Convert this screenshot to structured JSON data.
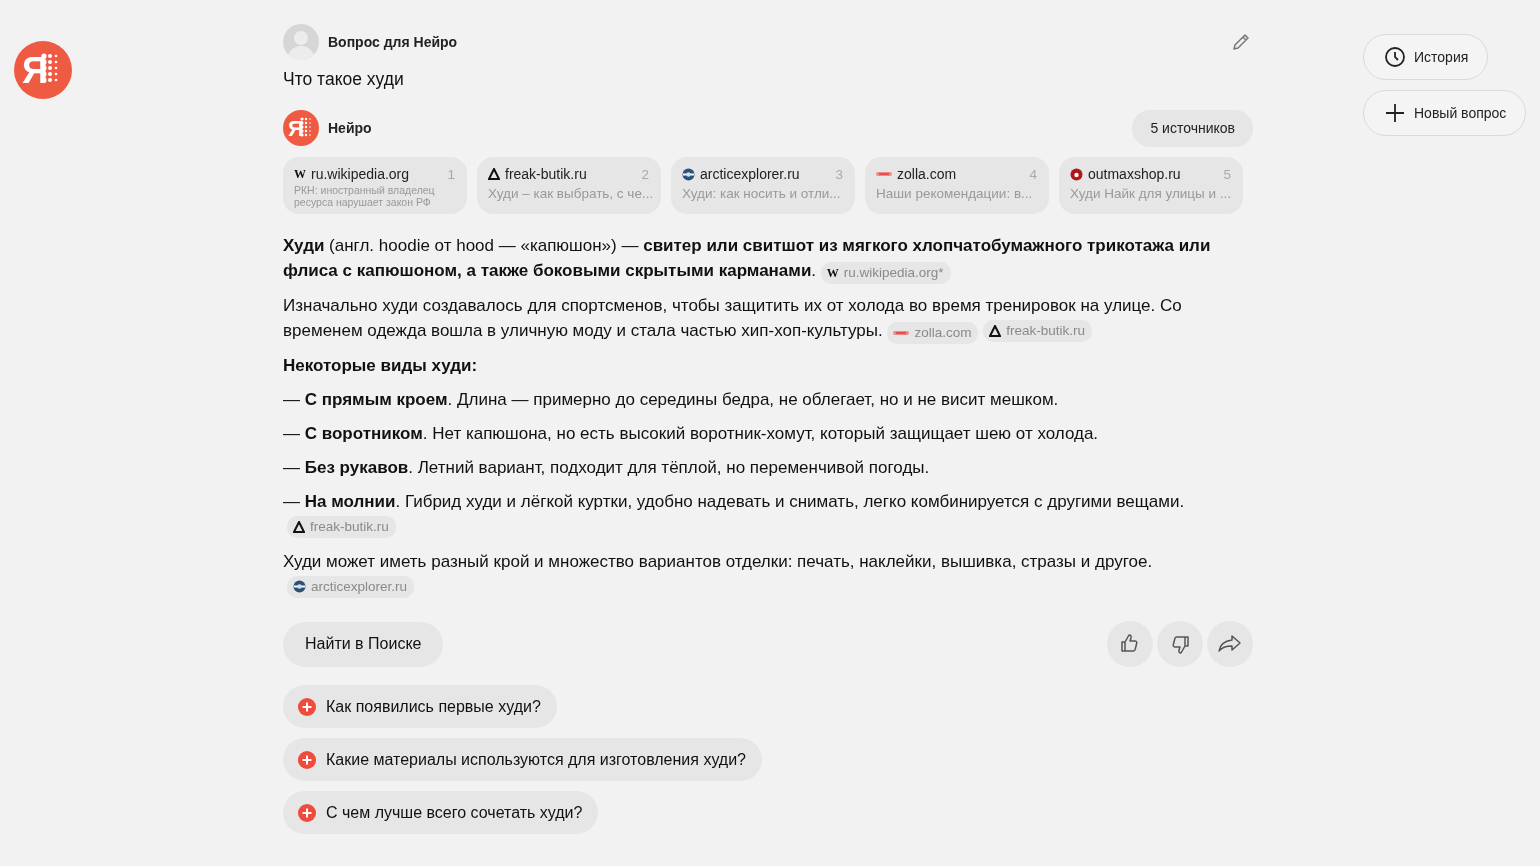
{
  "logo": {
    "letter": "Я"
  },
  "question": {
    "author": "Вопрос для Нейро",
    "text": "Что такое худи"
  },
  "answer": {
    "author": "Нейро",
    "author_letter": "Я",
    "sources_button": "5 источников",
    "sources": [
      {
        "domain": "ru.wikipedia.org",
        "number": "1",
        "snippet": "РКН: иностранный владелец ресурса нарушает закон РФ",
        "kind": "letter",
        "icon_text": "W",
        "warning": true
      },
      {
        "domain": "freak-butik.ru",
        "number": "2",
        "snippet": "Худи – как выбрать, с че...",
        "kind": "triangle",
        "warning": false
      },
      {
        "domain": "arcticexplorer.ru",
        "number": "3",
        "snippet": "Худи: как носить и отли...",
        "kind": "globe",
        "warning": false
      },
      {
        "domain": "zolla.com",
        "number": "4",
        "snippet": "Наши рекомендации: в...",
        "kind": "stripe",
        "warning": false
      },
      {
        "domain": "outmaxshop.ru",
        "number": "5",
        "snippet": "Худи Найк для улицы и ...",
        "kind": "dot",
        "warning": false
      }
    ],
    "blocks": [
      {
        "kind": "paragraph",
        "text": "**Худи** (англ. hoodie от hood — «капюшон») — **свитер или свитшот из мягкого хлопчатобумажного трикотажа или флиса с капюшоном, а также боковыми скрытыми карманами**.",
        "citations": [
          {
            "label": "ru.wikipedia.org*",
            "kind": "letter",
            "icon_text": "W"
          }
        ]
      },
      {
        "kind": "paragraph",
        "text": "Изначально худи создавалось для спортсменов, чтобы защитить их от холода во время тренировок на улице. Со временем одежда вошла в уличную моду и стала частью хип-хоп-культуры.",
        "citations": [
          {
            "label": "zolla.com",
            "kind": "stripe"
          },
          {
            "label": "freak-butik.ru",
            "kind": "triangle"
          }
        ]
      },
      {
        "kind": "heading",
        "text": "Некоторые виды худи:"
      },
      {
        "kind": "list_item",
        "text": "— **С прямым кроем**. Длина — примерно до середины бедра, не облегает, но и не висит мешком."
      },
      {
        "kind": "list_item",
        "text": "— **С воротником**. Нет капюшона, но есть высокий воротник-хомут, который защищает шею от холода."
      },
      {
        "kind": "list_item",
        "text": "— **Без рукавов**. Летний вариант, подходит для тёплой, но переменчивой погоды."
      },
      {
        "kind": "list_item",
        "text": "— **На молнии**. Гибрид худи и лёгкой куртки, удобно надевать и снимать, легко комбинируется с другими вещами."
      },
      {
        "kind": "citations",
        "citations": [
          {
            "label": "freak-butik.ru",
            "kind": "triangle"
          }
        ]
      },
      {
        "kind": "paragraph",
        "text": "Худи может иметь разный крой и множество вариантов отделки: печать, наклейки, вышивка, стразы и другое."
      },
      {
        "kind": "citations",
        "citations": [
          {
            "label": "arcticexplorer.ru",
            "kind": "globe"
          }
        ]
      }
    ],
    "search_button": "Найти в Поиске"
  },
  "suggestions": [
    "Как появились первые худи?",
    "Какие материалы используются для изготовления худи?",
    "С чем лучше всего сочетать худи?"
  ],
  "sidebar": [
    {
      "kind": "history",
      "label": "История"
    },
    {
      "kind": "new",
      "label": "Новый вопрос"
    }
  ]
}
